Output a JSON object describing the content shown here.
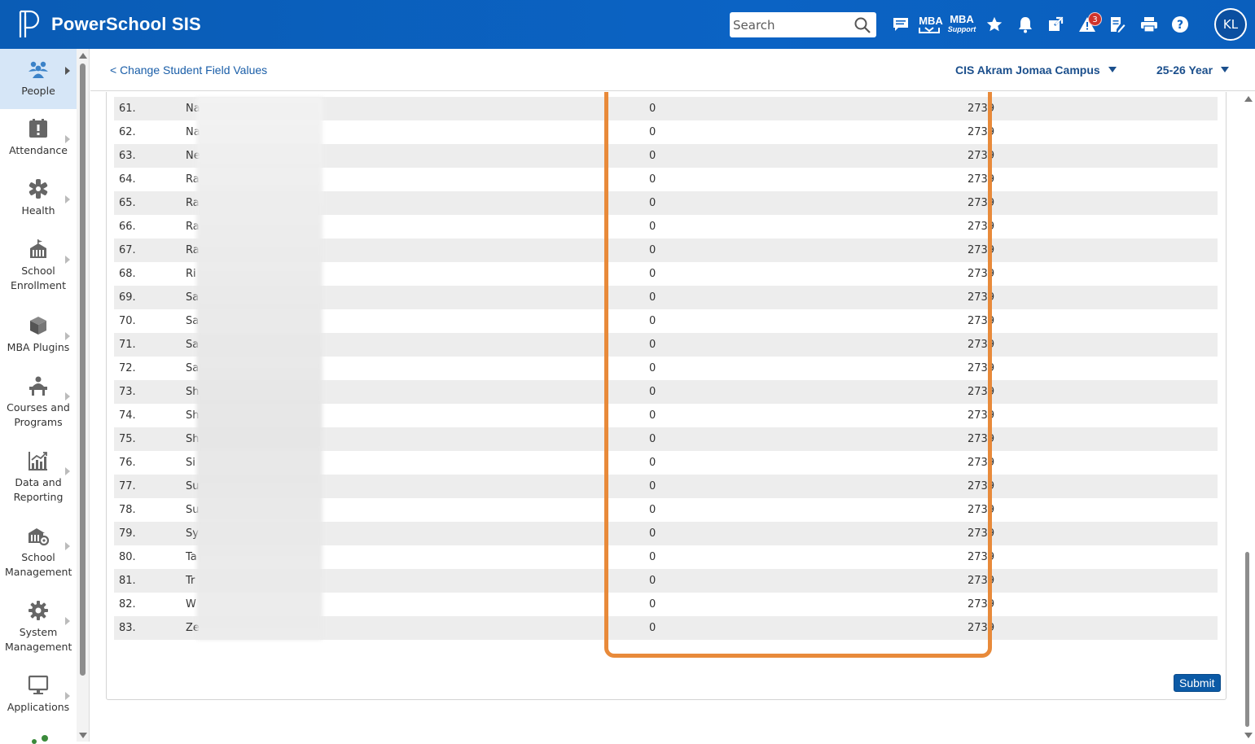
{
  "header": {
    "brand": "PowerSchool SIS",
    "search_placeholder": "Search",
    "mba_label": "MBA",
    "mba_support_label": "MBA",
    "mba_support_sub": "Support",
    "alert_count": "3",
    "user_initials": "KL"
  },
  "leftnav": {
    "items": [
      {
        "label": "People",
        "icon": "people-icon",
        "active": true
      },
      {
        "label": "Attendance",
        "icon": "attendance-icon"
      },
      {
        "label": "Health",
        "icon": "health-icon"
      },
      {
        "label": "School Enrollment",
        "icon": "school-enrollment-icon"
      },
      {
        "label": "MBA Plugins",
        "icon": "plugin-cube-icon"
      },
      {
        "label": "Courses and Programs",
        "icon": "courses-icon"
      },
      {
        "label": "Data and Reporting",
        "icon": "reporting-chart-icon"
      },
      {
        "label": "School Management",
        "icon": "school-management-icon"
      },
      {
        "label": "System Management",
        "icon": "gear-icon"
      },
      {
        "label": "Applications",
        "icon": "monitor-icon"
      }
    ]
  },
  "subheader": {
    "back_link": "< Change Student Field Values",
    "school": "CIS Akram Jomaa Campus",
    "term": "25-26 Year"
  },
  "table": {
    "rows": [
      {
        "num": "61.",
        "name": "Na",
        "v1": "0",
        "v2": "2739"
      },
      {
        "num": "62.",
        "name": "Na",
        "v1": "0",
        "v2": "2739"
      },
      {
        "num": "63.",
        "name": "Ne",
        "v1": "0",
        "v2": "2739"
      },
      {
        "num": "64.",
        "name": "Ra",
        "v1": "0",
        "v2": "2739"
      },
      {
        "num": "65.",
        "name": "Ra",
        "v1": "0",
        "v2": "2739"
      },
      {
        "num": "66.",
        "name": "Ra",
        "v1": "0",
        "v2": "2739"
      },
      {
        "num": "67.",
        "name": "Ra",
        "v1": "0",
        "v2": "2739"
      },
      {
        "num": "68.",
        "name": "Ri",
        "v1": "0",
        "v2": "2739"
      },
      {
        "num": "69.",
        "name": "Sa",
        "v1": "0",
        "v2": "2739"
      },
      {
        "num": "70.",
        "name": "Sa",
        "v1": "0",
        "v2": "2739"
      },
      {
        "num": "71.",
        "name": "Sa",
        "v1": "0",
        "v2": "2739"
      },
      {
        "num": "72.",
        "name": "Sa",
        "v1": "0",
        "v2": "2739"
      },
      {
        "num": "73.",
        "name": "Sh",
        "v1": "0",
        "v2": "2739"
      },
      {
        "num": "74.",
        "name": "Sh",
        "v1": "0",
        "v2": "2739"
      },
      {
        "num": "75.",
        "name": "Sh",
        "v1": "0",
        "v2": "2739"
      },
      {
        "num": "76.",
        "name": "Si",
        "v1": "0",
        "v2": "2739"
      },
      {
        "num": "77.",
        "name": "Su",
        "v1": "0",
        "v2": "2739"
      },
      {
        "num": "78.",
        "name": "Su",
        "v1": "0",
        "v2": "2739"
      },
      {
        "num": "79.",
        "name": "Sy",
        "v1": "0",
        "v2": "2739"
      },
      {
        "num": "80.",
        "name": "Ta",
        "v1": "0",
        "v2": "2739"
      },
      {
        "num": "81.",
        "name": "Tr",
        "v1": "0",
        "v2": "2739"
      },
      {
        "num": "82.",
        "name": "W",
        "v1": "0",
        "v2": "2739"
      },
      {
        "num": "83.",
        "name": "Ze",
        "v1": "0",
        "v2": "2739"
      }
    ]
  },
  "actions": {
    "submit_label": "Submit"
  },
  "colors": {
    "header_blue": "#0b63c4",
    "highlight_orange": "#e88a3a",
    "link_blue": "#1a5ea8",
    "submit_blue": "#0b5aa6"
  }
}
